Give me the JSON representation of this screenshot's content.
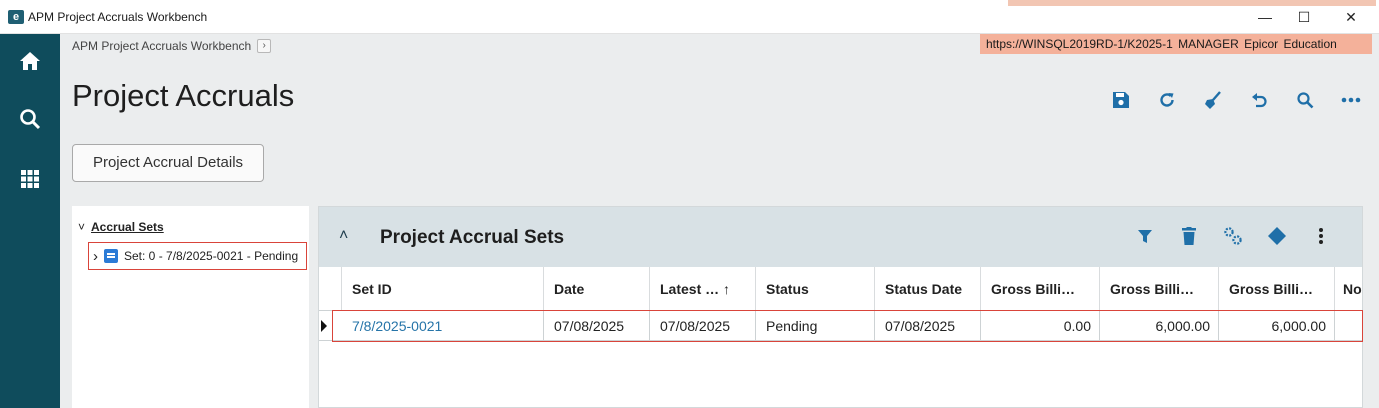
{
  "window": {
    "title": "APM Project Accruals Workbench",
    "app_icon_glyph": "e",
    "controls": {
      "minimize": "—",
      "maximize": "☐",
      "close": "✕"
    }
  },
  "nav": {
    "items": [
      "home-icon",
      "search-icon",
      "apps-grid-icon"
    ],
    "background": "#0f4c5c"
  },
  "header": {
    "breadcrumb": "APM Project Accruals Workbench",
    "breadcrumb_arrow": "›",
    "environment": "https://WINSQL2019RD-1/K2025-1  MANAGER  Epicor Education",
    "page_title": "Project Accruals",
    "toolbar_icons": [
      "save-icon",
      "refresh-icon",
      "clear-icon",
      "undo-icon",
      "search-icon",
      "more-icon"
    ]
  },
  "details_button": "Project Accrual Details",
  "tree": {
    "expander_collapse": "˅",
    "header": "Accrual Sets",
    "node_expander": "›",
    "node": "Set: 0 - 7/8/2025-0021 - Pending"
  },
  "grid": {
    "title": "Project Accrual Sets",
    "collapse_glyph": "˄",
    "tool_icons": [
      "filter-icon",
      "delete-icon",
      "settings-icon",
      "diamond-icon",
      "kebab-icon"
    ],
    "columns": [
      "Set ID",
      "Date",
      "Latest … ↑",
      "Status",
      "Status Date",
      "Gross Billi…",
      "Gross Billi…",
      "Gross Billi…",
      "No"
    ],
    "rows": [
      {
        "set_id": "7/8/2025-0021",
        "date": "07/08/2025",
        "latest": "07/08/2025",
        "status": "Pending",
        "status_date": "07/08/2025",
        "gross1": "0.00",
        "gross2": "6,000.00",
        "gross3": "6,000.00",
        "no": ""
      }
    ]
  },
  "colors": {
    "accent": "#0f4c5c",
    "highlight": "#d9443a",
    "env_banner": "#f4b19a",
    "link": "#2674a8",
    "icon": "#1f6fa8"
  }
}
